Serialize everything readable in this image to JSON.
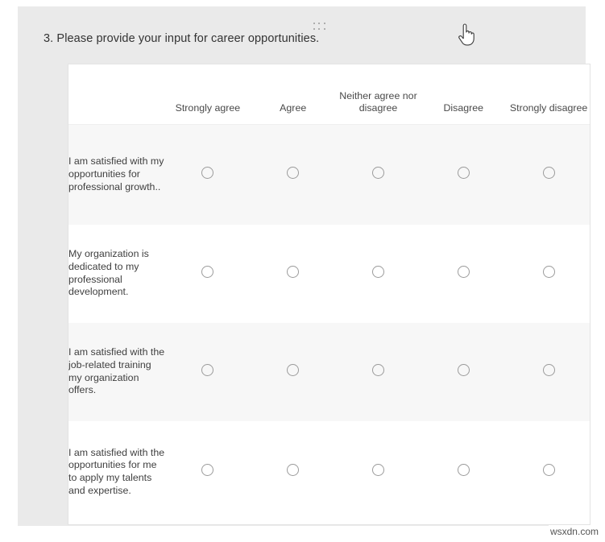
{
  "question": {
    "number_and_text": "3. Please provide your input for career opportunities.",
    "drag_handle_label": "drag-handle"
  },
  "matrix": {
    "row_header_blank": "",
    "columns": [
      "Strongly agree",
      "Agree",
      "Neither agree nor disagree",
      "Disagree",
      "Strongly disagree"
    ],
    "rows": [
      {
        "label": "I am satisfied with my opportunities for professional growth..",
        "selected": null
      },
      {
        "label": "My organization is dedicated to my professional development.",
        "selected": null
      },
      {
        "label": "I am satisfied with the job-related training my organization offers.",
        "selected": null
      },
      {
        "label": "I am satisfied with the opportunities for me to apply my talents and expertise.",
        "selected": null
      }
    ]
  },
  "cursor": {
    "type": "pointing-hand-cursor"
  },
  "watermark": {
    "text": "wsxdn.com"
  },
  "colors": {
    "panel_background": "#eaeaea",
    "card_background": "#ffffff",
    "row_shaded": "#f7f7f7",
    "text": "#3f3f3f",
    "radio_border": "#9b9b9b",
    "page_background": "#ffffff"
  }
}
